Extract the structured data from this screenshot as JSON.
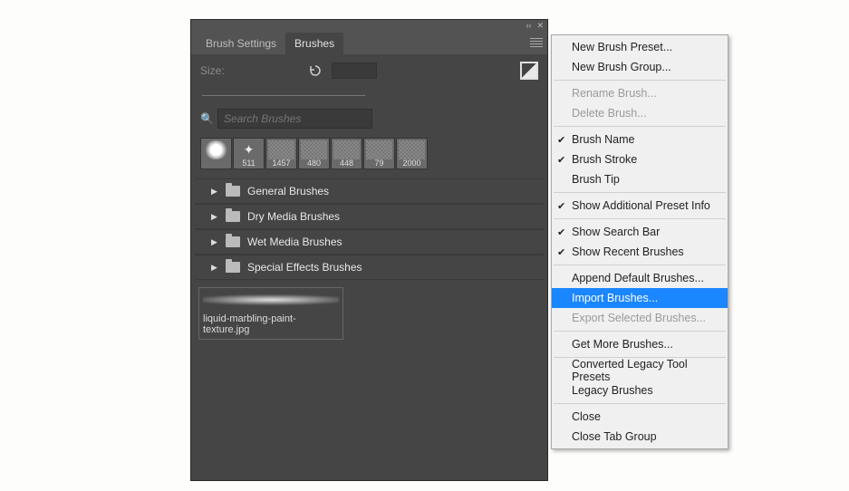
{
  "tabs": {
    "settings": "Brush Settings",
    "brushes": "Brushes"
  },
  "size": {
    "label": "Size:"
  },
  "search": {
    "placeholder": "Search Brushes"
  },
  "thumbs": [
    {
      "value": ""
    },
    {
      "value": "511"
    },
    {
      "value": "1457"
    },
    {
      "value": "480"
    },
    {
      "value": "448"
    },
    {
      "value": "79"
    },
    {
      "value": "2000"
    }
  ],
  "folders": [
    "General Brushes",
    "Dry Media Brushes",
    "Wet Media Brushes",
    "Special Effects Brushes"
  ],
  "recent": {
    "label": "liquid-marbling-paint-texture.jpg"
  },
  "menu": {
    "newPreset": "New Brush Preset...",
    "newGroup": "New Brush Group...",
    "rename": "Rename Brush...",
    "delete": "Delete Brush...",
    "brushName": "Brush Name",
    "brushStroke": "Brush Stroke",
    "brushTip": "Brush Tip",
    "showAdditional": "Show Additional Preset Info",
    "showSearch": "Show Search Bar",
    "showRecent": "Show Recent Brushes",
    "appendDefault": "Append Default Brushes...",
    "import": "Import Brushes...",
    "exportSelected": "Export Selected Brushes...",
    "getMore": "Get More Brushes...",
    "convertedLegacy": "Converted Legacy Tool Presets",
    "legacy": "Legacy Brushes",
    "close": "Close",
    "closeGroup": "Close Tab Group"
  }
}
